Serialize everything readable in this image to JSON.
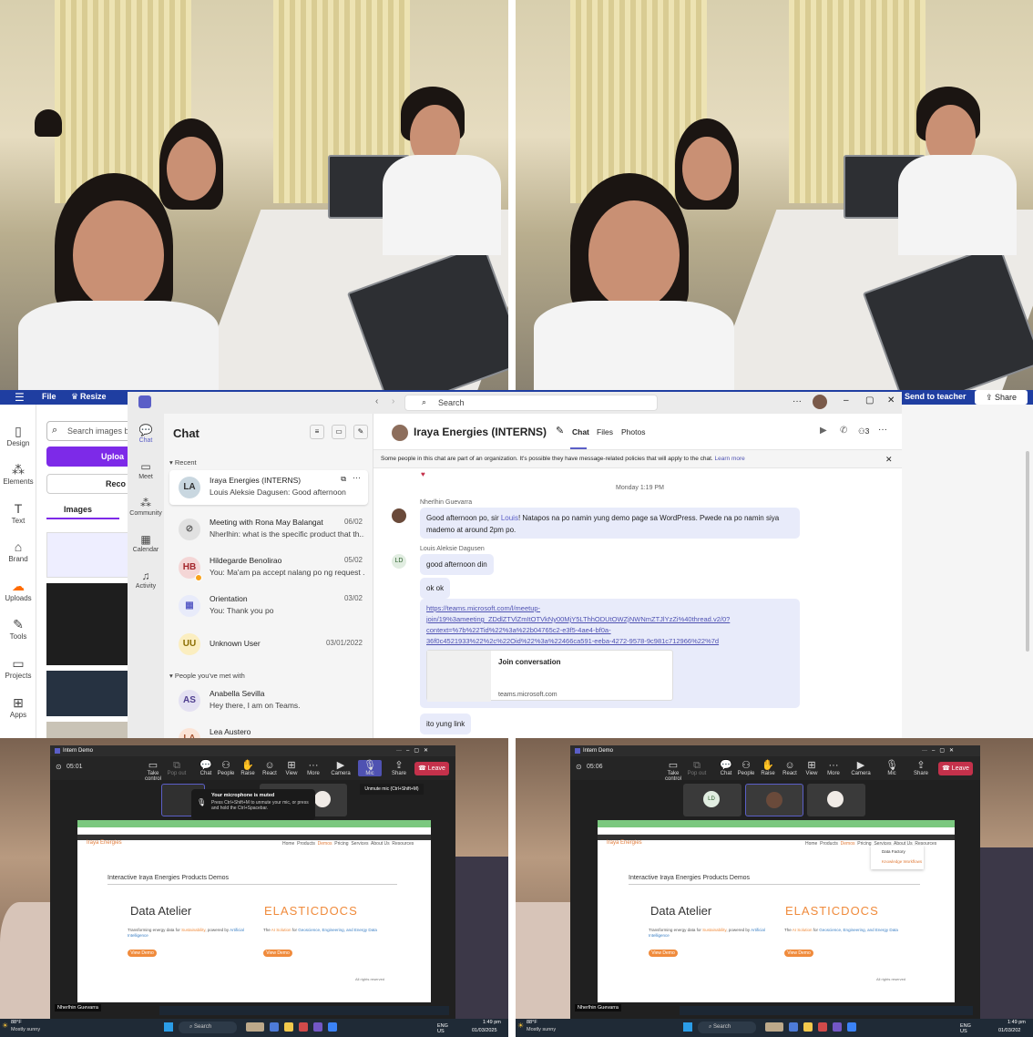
{
  "canva": {
    "menu_file": "File",
    "menu_resize": "Resize",
    "send_to_teacher": "Send to teacher",
    "share": "Share",
    "search_placeholder": "Search images b",
    "upload_button": "Uploa",
    "record_button": "Reco",
    "tab_images": "Images",
    "sidebar": [
      {
        "label": "Design",
        "icon": "design-icon"
      },
      {
        "label": "Elements",
        "icon": "elements-icon"
      },
      {
        "label": "Text",
        "icon": "text-icon"
      },
      {
        "label": "Brand",
        "icon": "brand-icon"
      },
      {
        "label": "Uploads",
        "icon": "uploads-icon"
      },
      {
        "label": "Tools",
        "icon": "tools-icon"
      },
      {
        "label": "Projects",
        "icon": "projects-icon"
      },
      {
        "label": "Apps",
        "icon": "apps-icon"
      }
    ]
  },
  "teams": {
    "search_placeholder": "Search",
    "rail": [
      {
        "label": "Chat",
        "icon": "chat-icon"
      },
      {
        "label": "Meet",
        "icon": "meet-icon"
      },
      {
        "label": "Community",
        "icon": "community-icon"
      },
      {
        "label": "Calendar",
        "icon": "calendar-icon"
      },
      {
        "label": "Activity",
        "icon": "bell-icon"
      }
    ],
    "chat_title": "Chat",
    "recent_label": "Recent",
    "people_met_label": "People you've met with",
    "chats": [
      {
        "initials": "LA",
        "name": "Iraya Energies (INTERNS)",
        "preview": "Louis Aleksie Dagusen: Good afternoon",
        "date": ""
      },
      {
        "initials": "",
        "name": "Meeting with Rona May Balangat",
        "preview": "Nherlhin: what is the specific product that th...",
        "date": "06/02"
      },
      {
        "initials": "HB",
        "name": "Hildegarde Benolirao",
        "preview": "You: Ma'am pa accept nalang po ng request ...",
        "date": "05/02"
      },
      {
        "initials": "",
        "name": "Orientation",
        "preview": "You: Thank you po",
        "date": "03/02"
      },
      {
        "initials": "UU",
        "name": "Unknown User",
        "preview": "",
        "date": "03/01/2022"
      }
    ],
    "people": [
      {
        "initials": "AS",
        "name": "Anabella Sevilla",
        "preview": "Hey there, I am on Teams."
      },
      {
        "initials": "LA",
        "name": "Lea Austero",
        "preview": ""
      }
    ],
    "conversation": {
      "title": "Iraya Energies (INTERNS)",
      "tabs": [
        "Chat",
        "Files",
        "Photos"
      ],
      "participants_count": "3",
      "policy_notice": "Some people in this chat are part of an organization. It's possible they have message-related policies that will apply to the chat.",
      "learn_more": "Learn more",
      "day_divider": "Monday 1:19 PM",
      "sender1": "Nherlhin Guevarra",
      "msg1_before": "Good afternoon po, sir ",
      "msg1_mention": "Louis",
      "msg1_after": "! Natapos na po namin yung demo page sa WordPress. Pwede na po namin siya mademo at around 2pm po.",
      "sender2": "Louis Aleksie Dagusen",
      "sender2_initials": "LD",
      "msg2": "good afternoon din",
      "msg3": "ok ok",
      "link_line1": "https://teams.microsoft.com/l/meetup-",
      "link_line2": "join/19%3ameeting_ZDdlZTVlZmItOTVkNy00MjY5LThhODUtOWZjNWNmZTJlYzZi%40thread.v2/0?",
      "link_line3": "context=%7b%22Tid%22%3a%22b04765c2-e3f5-4ae4-bf0a-",
      "link_line4": "36f0c4521933%22%2c%22Oid%22%3a%22466ca591-eeba-4272-9578-9c981c712966%22%7d",
      "card_title": "Join conversation",
      "card_domain": "teams.microsoft.com",
      "msg4": "ito yung link"
    }
  },
  "meeting_left": {
    "title": "Intern Demo",
    "timer": "05:01",
    "controls": [
      "Take control",
      "Pop out",
      "Chat",
      "People",
      "Raise",
      "React",
      "View",
      "More",
      "Camera",
      "Mic",
      "Share"
    ],
    "leave": "Leave",
    "mute_title": "Your microphone is muted",
    "mute_body": "Press Ctrl+Shift+M to unmute your mic, or press and hold the Ctrl+Spacebar.",
    "unmute_tooltip": "Unmute mic (Ctrl+Shift+M)",
    "presenter": "Nherlhin Guevarra",
    "weather_temp": "88°F",
    "weather_desc": "Mostly sunny",
    "search": "Search",
    "lang": "ENG US",
    "time": "1:49 pm",
    "date": "01/03/2025"
  },
  "meeting_right": {
    "title": "Intern Demo",
    "timer": "05:06",
    "participant_initials": "LD",
    "leave": "Leave",
    "presenter": "Nherlhin Guevarra",
    "weather_temp": "88°F",
    "weather_desc": "Mostly sunny",
    "search": "Search",
    "lang": "ENG US",
    "time": "1:49 pm",
    "date": "01/03/202",
    "dropdown_item1": "Data Factory",
    "dropdown_item2": "Knowledge Workflows"
  },
  "website": {
    "brand": "Iraya Energies",
    "nav": [
      "Home",
      "Products",
      "Demos",
      "Pricing",
      "Services",
      "About Us",
      "Resources"
    ],
    "heading": "Interactive Iraya Energies Products Demos",
    "product1_name": "Data Atelier",
    "product1_desc_pre": "Transforming energy data for ",
    "product1_desc_hl1": "Sustainability",
    "product1_desc_mid": ", powered by ",
    "product1_desc_hl2": "Artificial Intelligence",
    "product2_name": "ELASTICDOCS",
    "product2_desc_pre": "The ",
    "product2_desc_hl1": "AI Solution",
    "product2_desc_mid": " for ",
    "product2_desc_hl2": "Geoscience, Engineering, and Energy Data",
    "view_demo": "View Demo",
    "footer": "All rights reserved"
  }
}
